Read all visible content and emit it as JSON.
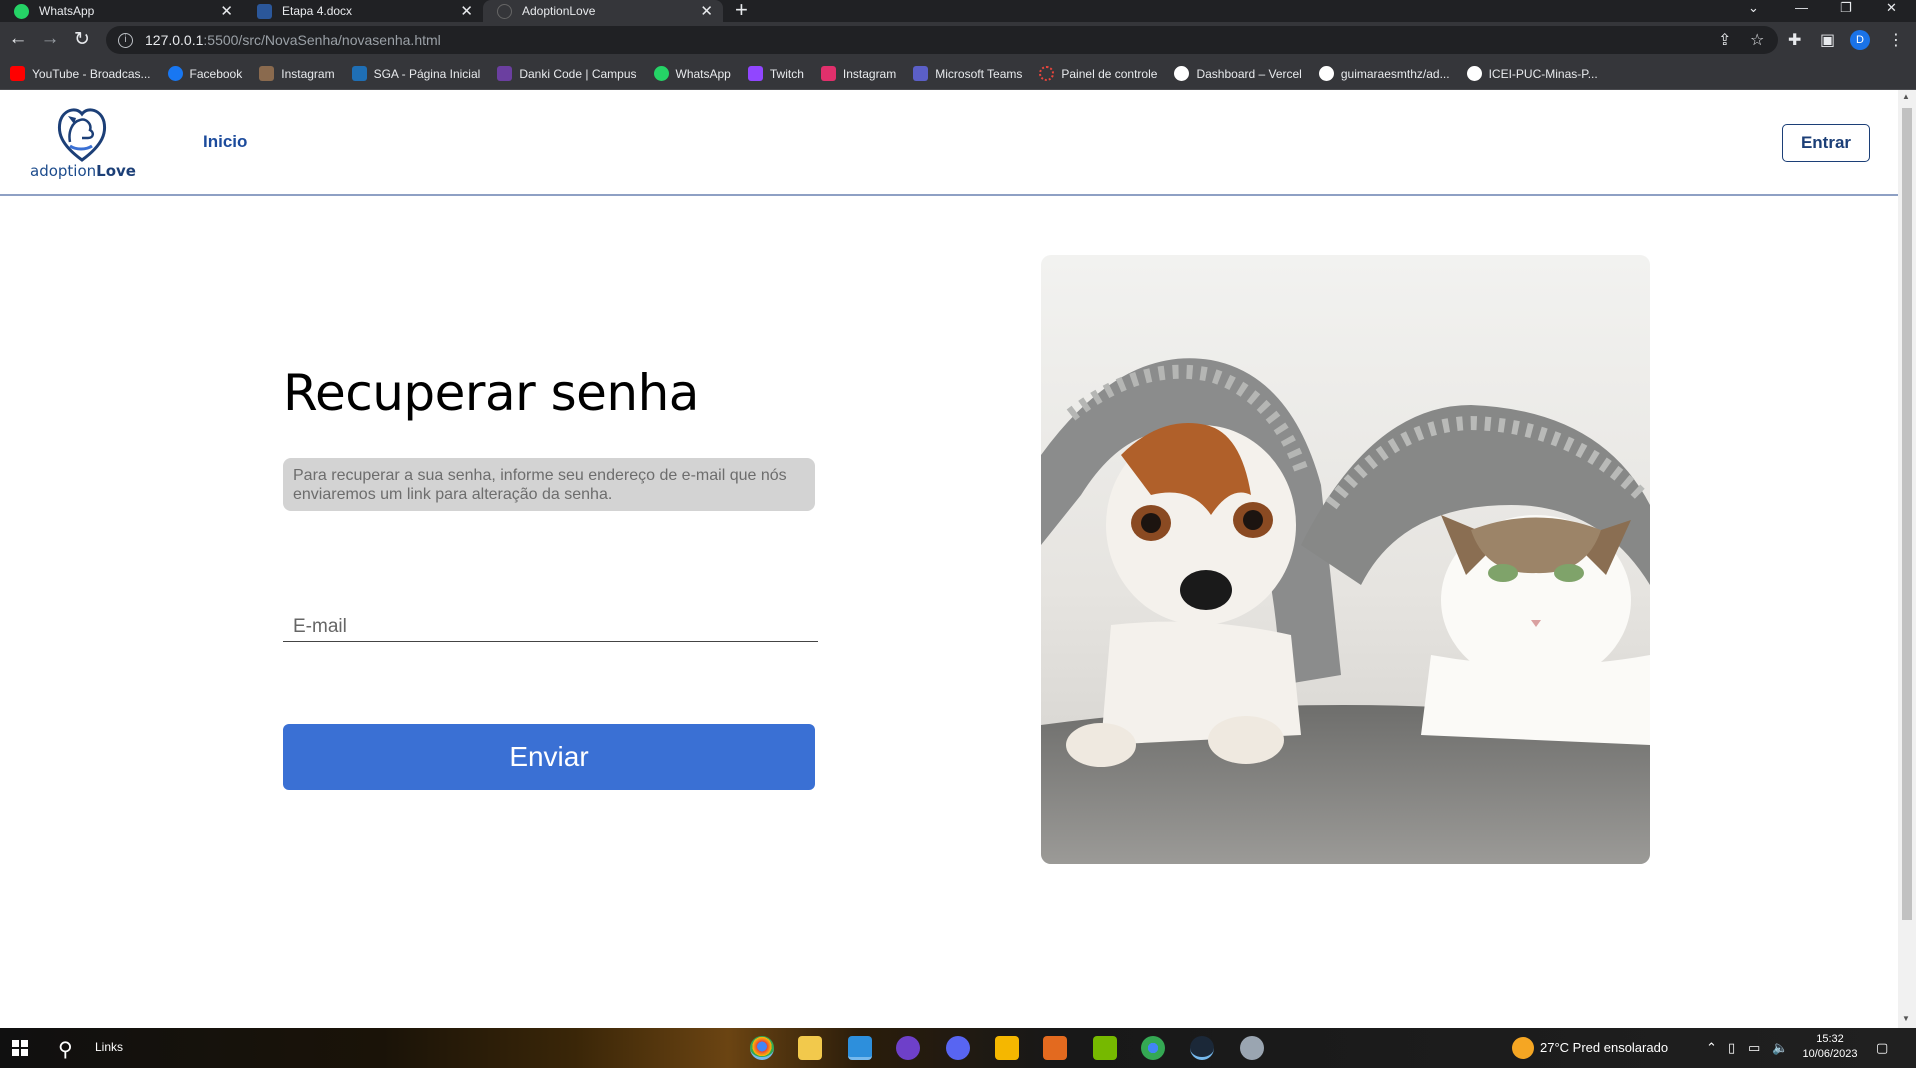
{
  "browser": {
    "tabs": [
      {
        "title": "WhatsApp",
        "favicon_color": "#25d366"
      },
      {
        "title": "Etapa 4.docx",
        "favicon_color": "#2b579a"
      },
      {
        "title": "AdoptionLove",
        "favicon_color": "#35363a"
      }
    ],
    "address": {
      "host": "127.0.0.1",
      "path": ":5500/src/NovaSenha/novasenha.html"
    },
    "profile_initial": "D",
    "bookmarks": [
      {
        "label": "YouTube - Broadcas...",
        "color": "#ff0000"
      },
      {
        "label": "Facebook",
        "color": "#1877f2"
      },
      {
        "label": "Instagram",
        "color": "#8a6a4e"
      },
      {
        "label": "SGA - Página Inicial",
        "color": "#1f6fb5"
      },
      {
        "label": "Danki Code | Campus",
        "color": "#6b3fa0"
      },
      {
        "label": "WhatsApp",
        "color": "#25d366"
      },
      {
        "label": "Twitch",
        "color": "#9146ff"
      },
      {
        "label": "Instagram",
        "color": "#e1306c"
      },
      {
        "label": "Microsoft Teams",
        "color": "#5b5fc7"
      },
      {
        "label": "Painel de controle",
        "color": "#e8453c"
      },
      {
        "label": "Dashboard – Vercel",
        "color": "#ffffff"
      },
      {
        "label": "guimaraesmthz/ad...",
        "color": "#ffffff"
      },
      {
        "label": "ICEI-PUC-Minas-P...",
        "color": "#ffffff"
      }
    ]
  },
  "header": {
    "logo_text_light": "adoption",
    "logo_text_bold": "Love",
    "nav_inicio": "Inicio",
    "login_button": "Entrar"
  },
  "form": {
    "title": "Recuperar senha",
    "description": "Para recuperar a sua senha, informe seu endereço de e-mail que nós enviaremos um link para alteração da senha.",
    "email_placeholder": "E-mail",
    "email_value": "",
    "submit_label": "Enviar"
  },
  "colors": {
    "brand_blue": "#1c3f77",
    "button_blue": "#3a70d4"
  },
  "taskbar": {
    "links_label": "Links",
    "weather": "27°C  Pred ensolarado",
    "time": "15:32",
    "date": "10/06/2023"
  }
}
